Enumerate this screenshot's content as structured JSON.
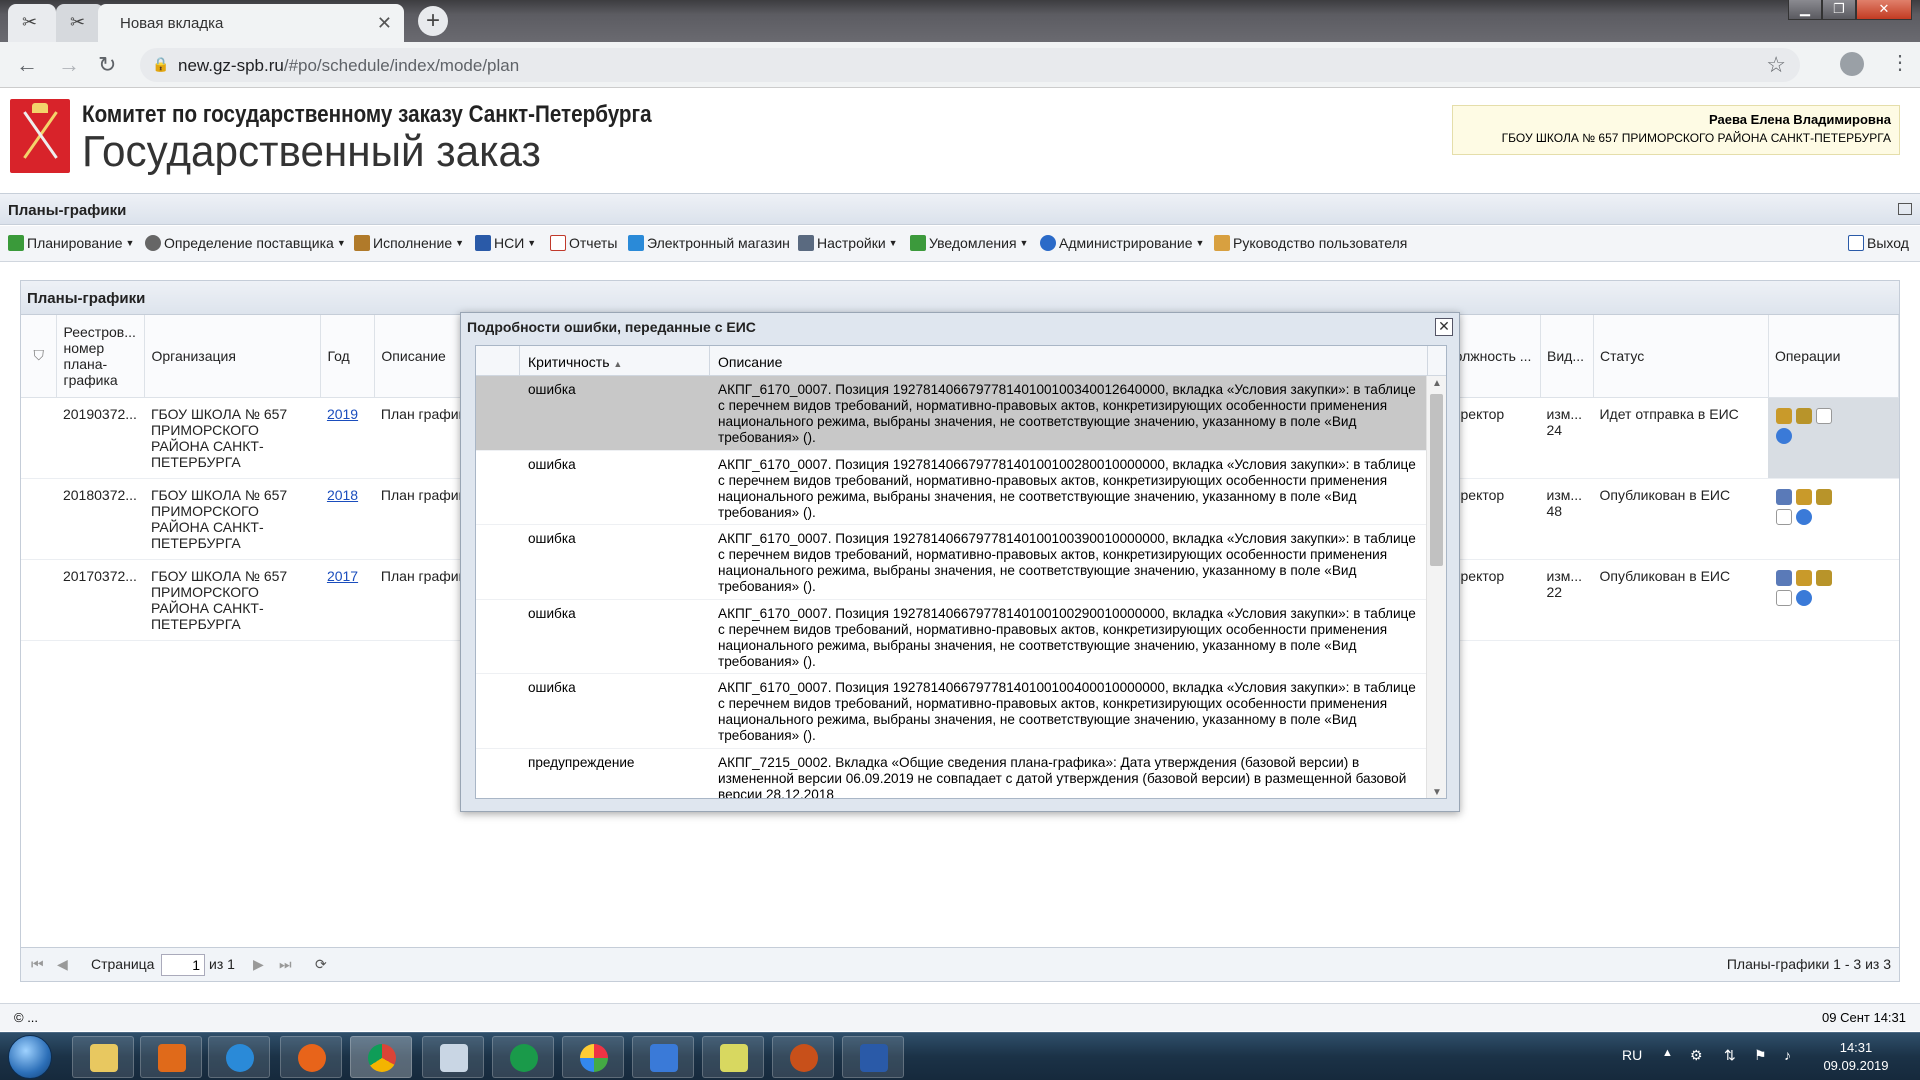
{
  "browser": {
    "tab_title": "Новая вкладка",
    "tab_close": "✕",
    "new_tab": "+",
    "url_domain": "new.gz-spb.ru",
    "url_path": "/#po/schedule/index/mode/plan"
  },
  "header": {
    "org_line": "Комитет по государственному заказу Санкт-Петербурга",
    "app_title": "Государственный заказ",
    "user_name": "Раева Елена Владимировна",
    "user_org": "ГБОУ ШКОЛА № 657 ПРИМОРСКОГО РАЙОНА САНКТ-ПЕТЕРБУРГА"
  },
  "panel": {
    "title": "Планы-графики"
  },
  "menu": [
    {
      "label": "Планирование",
      "icon": "planning-icon",
      "color": "#3a9a3a",
      "caret": true
    },
    {
      "label": "Определение поставщика",
      "icon": "gear-icon",
      "color": "#666666",
      "caret": true
    },
    {
      "label": "Исполнение",
      "icon": "truck-icon",
      "color": "#b07a2a",
      "caret": true
    },
    {
      "label": "НСИ",
      "icon": "book-icon",
      "color": "#2a5aa8",
      "caret": true
    },
    {
      "label": "Отчеты",
      "icon": "report-icon",
      "color": "#c0392b",
      "caret": false
    },
    {
      "label": "Электронный магазин",
      "icon": "cart-icon",
      "color": "#2a8ad8",
      "caret": false
    },
    {
      "label": "Настройки",
      "icon": "wrench-icon",
      "color": "#5a6a80",
      "caret": true
    },
    {
      "label": "Уведомления",
      "icon": "notification-icon",
      "color": "#3c9a3c",
      "caret": true
    },
    {
      "label": "Администрирование",
      "icon": "user-admin-icon",
      "color": "#2a6ac8",
      "caret": true
    },
    {
      "label": "Руководство пользователя",
      "icon": "manual-icon",
      "color": "#d8a040",
      "caret": false
    }
  ],
  "logout": "Выход",
  "grid": {
    "title": "Планы-графики",
    "columns": {
      "reg": "Реестров... номер плана-графика",
      "org": "Организация",
      "year": "Год",
      "desc": "Описание",
      "position": "Должность ...",
      "kind": "Вид...",
      "status": "Статус",
      "ops": "Операции"
    },
    "rows": [
      {
        "reg": "20190372...",
        "org": "ГБОУ ШКОЛА № 657 ПРИМОРСКОГО РАЙОНА САНКТ-ПЕТЕРБУРГА",
        "year": "2019",
        "desc": "План график",
        "position": "директор",
        "kind": "изм... 24",
        "status": "Идет отправка в ЕИС"
      },
      {
        "reg": "20180372...",
        "org": "ГБОУ ШКОЛА № 657 ПРИМОРСКОГО РАЙОНА САНКТ-ПЕТЕРБУРГА",
        "year": "2018",
        "desc": "План график",
        "position": "директор",
        "kind": "изм... 48",
        "status": "Опубликован в ЕИС"
      },
      {
        "reg": "20170372...",
        "org": "ГБОУ ШКОЛА № 657 ПРИМОРСКОГО РАЙОНА САНКТ-ПЕТЕРБУРГА",
        "year": "2017",
        "desc": "План график",
        "position": "директор",
        "kind": "изм... 22",
        "status": "Опубликован в ЕИС"
      }
    ],
    "pager": {
      "page_label": "Страница",
      "page_value": "1",
      "of_label": "из 1",
      "summary": "Планы-графики 1 - 3 из 3"
    }
  },
  "modal": {
    "title": "Подробности ошибки, переданные с ЕИС",
    "col_severity": "Критичность",
    "col_description": "Описание",
    "rows": [
      {
        "severity": "ошибка",
        "text": "АКПГ_6170_0007. Позиция 192781406679778140100100340012640000, вкладка «Условия закупки»: в таблице с перечнем видов требований, нормативно-правовых актов, конкретизирующих особенности применения национального режима, выбраны значения, не соответствующие значению, указанному в поле «Вид требования» ()."
      },
      {
        "severity": "ошибка",
        "text": "АКПГ_6170_0007. Позиция 192781406679778140100100280010000000, вкладка «Условия закупки»: в таблице с перечнем видов требований, нормативно-правовых актов, конкретизирующих особенности применения национального режима, выбраны значения, не соответствующие значению, указанному в поле «Вид требования» ()."
      },
      {
        "severity": "ошибка",
        "text": "АКПГ_6170_0007. Позиция 192781406679778140100100390010000000, вкладка «Условия закупки»: в таблице с перечнем видов требований, нормативно-правовых актов, конкретизирующих особенности применения национального режима, выбраны значения, не соответствующие значению, указанному в поле «Вид требования» ()."
      },
      {
        "severity": "ошибка",
        "text": "АКПГ_6170_0007. Позиция 192781406679778140100100290010000000, вкладка «Условия закупки»: в таблице с перечнем видов требований, нормативно-правовых актов, конкретизирующих особенности применения национального режима, выбраны значения, не соответствующие значению, указанному в поле «Вид требования» ()."
      },
      {
        "severity": "ошибка",
        "text": "АКПГ_6170_0007. Позиция 192781406679778140100100400010000000, вкладка «Условия закупки»: в таблице с перечнем видов требований, нормативно-правовых актов, конкретизирующих особенности применения национального режима, выбраны значения, не соответствующие значению, указанному в поле «Вид требования» ()."
      },
      {
        "severity": "предупреждение",
        "text": "АКПГ_7215_0002. Вкладка «Общие сведения плана-графика»: Дата утверждения (базовой версии) в измененной версии 06.09.2019 не совпадает с датой утверждения (базовой версии) в размещенной базовой версии 28.12.2018"
      }
    ]
  },
  "status_bar": {
    "copyright": "© ...",
    "datetime": "09 Сент 14:31"
  },
  "taskbar": {
    "lang": "RU",
    "time": "14:31",
    "date": "09.09.2019"
  }
}
